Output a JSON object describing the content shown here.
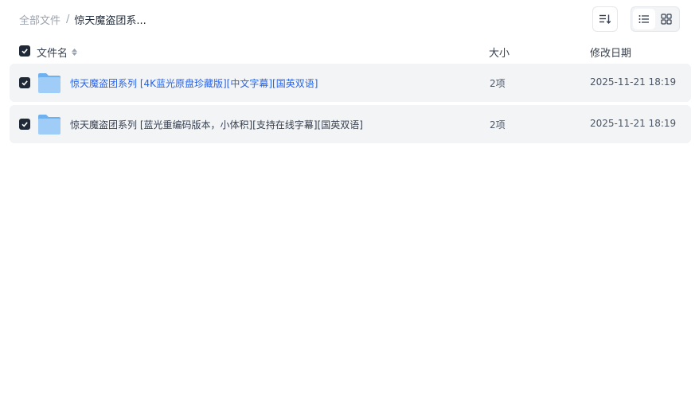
{
  "breadcrumb": {
    "root": "全部文件",
    "separator": "/",
    "current": "惊天魔盗团系..."
  },
  "toolbar": {
    "sort_icon": "sort-list-icon",
    "view_modes": [
      {
        "name": "list",
        "icon": "list-view-icon",
        "active": true
      },
      {
        "name": "grid",
        "icon": "grid-view-icon",
        "active": false
      }
    ]
  },
  "table": {
    "columns": {
      "name": "文件名",
      "size": "大小",
      "modified": "修改日期"
    },
    "select_all_checked": true,
    "rows": [
      {
        "checked": true,
        "icon": "folder-icon",
        "name": "惊天魔盗团系列 [4K蓝光原盘珍藏版][中文字幕][国英双语]",
        "size": "2项",
        "modified": "2025-11-21 18:19",
        "highlighted": true
      },
      {
        "checked": true,
        "icon": "folder-icon",
        "name": "惊天魔盗团系列 [蓝光重编码版本，小体积][支持在线字幕][国英双语]",
        "size": "2项",
        "modified": "2025-11-21 18:19",
        "highlighted": false
      }
    ]
  },
  "colors": {
    "accent": "#2563eb",
    "row_bg": "#f3f4f6",
    "checkbox": "#1f2937",
    "folder": "#8cc4f5"
  }
}
